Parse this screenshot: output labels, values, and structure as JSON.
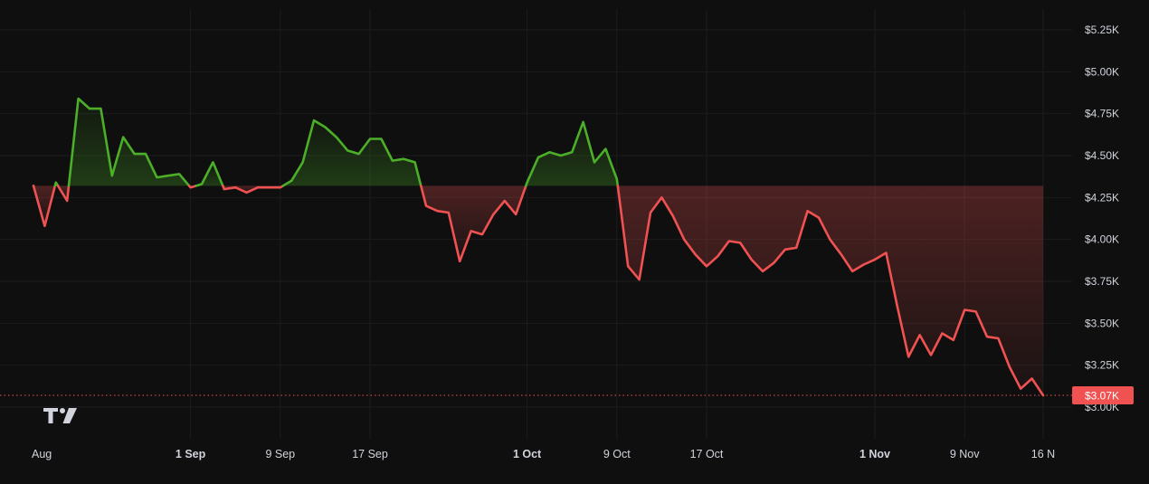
{
  "chart_data": {
    "type": "line",
    "y_unit": "USD",
    "ylim": [
      2840,
      5300
    ],
    "baseline_value": 4320,
    "y_ticks": [
      {
        "value": 5250,
        "label": "$5.25K"
      },
      {
        "value": 5000,
        "label": "$5.00K"
      },
      {
        "value": 4750,
        "label": "$4.75K"
      },
      {
        "value": 4500,
        "label": "$4.50K"
      },
      {
        "value": 4250,
        "label": "$4.25K"
      },
      {
        "value": 4000,
        "label": "$4.00K"
      },
      {
        "value": 3750,
        "label": "$3.75K"
      },
      {
        "value": 3500,
        "label": "$3.50K"
      },
      {
        "value": 3250,
        "label": "$3.25K"
      },
      {
        "value": 3000,
        "label": "$3.00K"
      }
    ],
    "x_ticks": [
      {
        "date": "2025-08-01",
        "label": "Aug",
        "bold": false
      },
      {
        "date": "2025-09-01",
        "label": "1 Sep",
        "bold": true
      },
      {
        "date": "2025-09-09",
        "label": "9 Sep",
        "bold": false
      },
      {
        "date": "2025-09-17",
        "label": "17 Sep",
        "bold": false
      },
      {
        "date": "2025-10-01",
        "label": "1 Oct",
        "bold": true
      },
      {
        "date": "2025-10-09",
        "label": "9 Oct",
        "bold": false
      },
      {
        "date": "2025-10-17",
        "label": "17 Oct",
        "bold": false
      },
      {
        "date": "2025-11-01",
        "label": "1 Nov",
        "bold": true
      },
      {
        "date": "2025-11-09",
        "label": "9 Nov",
        "bold": false
      },
      {
        "date": "2025-11-16",
        "label": "16 N",
        "bold": false
      }
    ],
    "last_price_label": "$3.07K",
    "last_price_value": 3070,
    "colors": {
      "up": "#4caf28",
      "down": "#f05252",
      "background": "#0f0f0f",
      "grid": "#1c1c1c",
      "price_label_bg": "#f05252"
    },
    "grid": true,
    "series": [
      {
        "dates": [
          "2025-08-18",
          "2025-08-19",
          "2025-08-20",
          "2025-08-21",
          "2025-08-22",
          "2025-08-23",
          "2025-08-24",
          "2025-08-25",
          "2025-08-26",
          "2025-08-27",
          "2025-08-28",
          "2025-08-29",
          "2025-08-30",
          "2025-08-31",
          "2025-09-01",
          "2025-09-02",
          "2025-09-03",
          "2025-09-04",
          "2025-09-05",
          "2025-09-06",
          "2025-09-07",
          "2025-09-08",
          "2025-09-09",
          "2025-09-10",
          "2025-09-11",
          "2025-09-12",
          "2025-09-13",
          "2025-09-14",
          "2025-09-15",
          "2025-09-16",
          "2025-09-17",
          "2025-09-18",
          "2025-09-19",
          "2025-09-20",
          "2025-09-21",
          "2025-09-22",
          "2025-09-23",
          "2025-09-24",
          "2025-09-25",
          "2025-09-26",
          "2025-09-27",
          "2025-09-28",
          "2025-09-29",
          "2025-09-30",
          "2025-10-01",
          "2025-10-02",
          "2025-10-03",
          "2025-10-04",
          "2025-10-05",
          "2025-10-06",
          "2025-10-07",
          "2025-10-08",
          "2025-10-09",
          "2025-10-10",
          "2025-10-11",
          "2025-10-12",
          "2025-10-13",
          "2025-10-14",
          "2025-10-15",
          "2025-10-16",
          "2025-10-17",
          "2025-10-18",
          "2025-10-19",
          "2025-10-20",
          "2025-10-21",
          "2025-10-22",
          "2025-10-23",
          "2025-10-24",
          "2025-10-25",
          "2025-10-26",
          "2025-10-27",
          "2025-10-28",
          "2025-10-29",
          "2025-10-30",
          "2025-10-31",
          "2025-11-01",
          "2025-11-02",
          "2025-11-03",
          "2025-11-04",
          "2025-11-05",
          "2025-11-06",
          "2025-11-07",
          "2025-11-08",
          "2025-11-09",
          "2025-11-10",
          "2025-11-11",
          "2025-11-12",
          "2025-11-13",
          "2025-11-14",
          "2025-11-15",
          "2025-11-16"
        ],
        "values": [
          4320,
          4080,
          4340,
          4230,
          4840,
          4780,
          4780,
          4380,
          4610,
          4510,
          4510,
          4370,
          4380,
          4390,
          4310,
          4330,
          4460,
          4300,
          4310,
          4280,
          4310,
          4310,
          4310,
          4350,
          4460,
          4710,
          4670,
          4610,
          4530,
          4510,
          4600,
          4600,
          4470,
          4480,
          4460,
          4200,
          4170,
          4160,
          3870,
          4050,
          4030,
          4150,
          4230,
          4150,
          4340,
          4490,
          4520,
          4500,
          4520,
          4700,
          4460,
          4540,
          4360,
          3840,
          3760,
          4160,
          4250,
          4140,
          4000,
          3910,
          3840,
          3900,
          3990,
          3980,
          3880,
          3810,
          3860,
          3940,
          3950,
          4170,
          4130,
          4000,
          3910,
          3810,
          3850,
          3880,
          3920,
          3600,
          3300,
          3430,
          3310,
          3440,
          3400,
          3580,
          3570,
          3420,
          3410,
          3240,
          3110,
          3170,
          3070
        ]
      }
    ]
  }
}
